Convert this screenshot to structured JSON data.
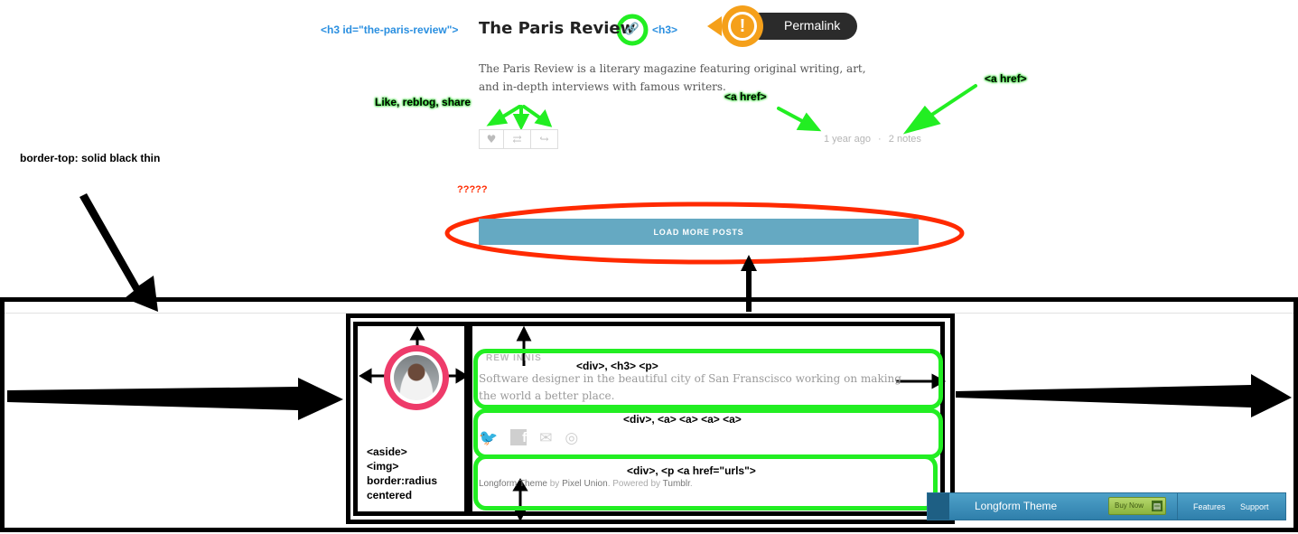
{
  "post": {
    "open_tag": "<h3 id=\"the-paris-review\">",
    "title": "The Paris Review",
    "close_tag": "<h3>",
    "permalink_label": "Permalink",
    "body": "The Paris Review is a literary magazine featuring original writing, art, and in-depth interviews with famous writers.",
    "actions_note": "Like, reblog, share",
    "time": "1 year ago",
    "separator": "·",
    "notes": "2 notes",
    "href_note_left": "<a href>",
    "href_note_right": "<a href>"
  },
  "annotations": {
    "border_top": "border-top: solid black thin",
    "question": "?????",
    "bio_tags": "<div>, <h3> <p>",
    "social_tags": "<div>, <a> <a> <a> <a>",
    "footer_tags": "<div>, <p <a href=\"urls\">",
    "aside_tags": [
      "<aside>",
      "<img>",
      "border:radius",
      "centered"
    ]
  },
  "load_more": {
    "label": "LOAD MORE POSTS"
  },
  "author": {
    "name_partial": "REW INNIS",
    "bio": "Software designer in the beautiful city of San Franscisco working on making the world a better place."
  },
  "credits": {
    "theme": "Longform Theme",
    "by": "by",
    "author": "Pixel Union",
    "sep": ".",
    "powered": "Powered by",
    "platform": "Tumblr",
    "end": "."
  },
  "theme_bar": {
    "name": "Longform Theme",
    "buy": "Buy Now",
    "features": "Features",
    "support": "Support"
  },
  "colors": {
    "annotation_green": "#22ee22",
    "annotation_red": "#ff2a00",
    "annotation_blue": "#2a8fe0",
    "load_button": "#65a9c2",
    "avatar_ring": "#ee3b6a"
  }
}
